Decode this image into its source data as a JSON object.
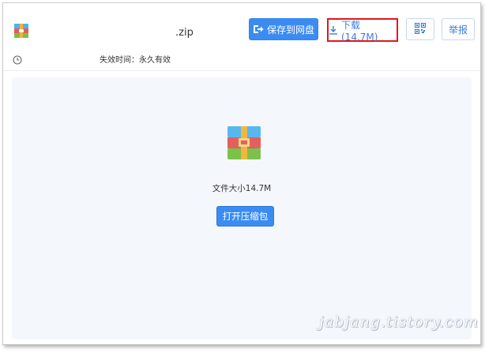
{
  "file": {
    "name": ".zip",
    "icon": "zip-archive-icon",
    "expiry_text": "失效时间：永久有效"
  },
  "toolbar": {
    "save_label": "保存到网盘",
    "download_label": "下载(14.7M)",
    "qr_icon": "qr-code-icon",
    "report_label": "举报"
  },
  "preview": {
    "size_text": "文件大小14.7M",
    "open_label": "打开压缩包"
  },
  "watermark": "jabjang.tistory.com",
  "colors": {
    "accent": "#3b8cf2",
    "highlight_border": "#e0171f",
    "panel_bg": "#f4f7fc"
  }
}
